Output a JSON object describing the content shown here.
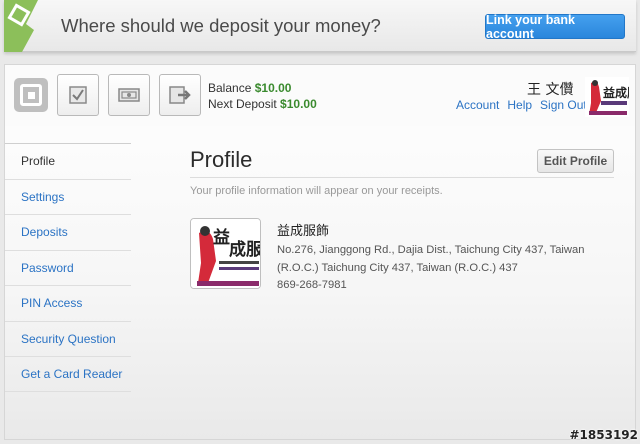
{
  "banner": {
    "message": "Where should we deposit your money?",
    "link_button": "Link your bank account"
  },
  "header": {
    "balance_label": "Balance",
    "balance_value": "$10.00",
    "next_deposit_label": "Next Deposit",
    "next_deposit_value": "$10.00",
    "user_name": "王 文儹",
    "links": [
      "Account",
      "Help",
      "Sign Out"
    ]
  },
  "sidebar": {
    "items": [
      {
        "label": "Profile"
      },
      {
        "label": "Settings"
      },
      {
        "label": "Deposits"
      },
      {
        "label": "Password"
      },
      {
        "label": "PIN Access"
      },
      {
        "label": "Security Question"
      },
      {
        "label": "Get a Card Reader"
      }
    ]
  },
  "profile": {
    "title": "Profile",
    "edit_button": "Edit Profile",
    "hint": "Your profile information will appear on your receipts.",
    "business_name": "益成服飾",
    "address_line1": "No.276, Jianggong Rd., Dajia Dist., Taichung City 437, Taiwan",
    "address_line2": "(R.O.C.) Taichung City 437, Taiwan (R.O.C.) 437",
    "phone": "869-268-7981"
  },
  "logo_text": "益成服",
  "watermark": "#1853192",
  "colors": {
    "accent": "#2a86dc",
    "link": "#2b73c4",
    "money": "#3a8a2e",
    "logo_red": "#c41e2a"
  }
}
